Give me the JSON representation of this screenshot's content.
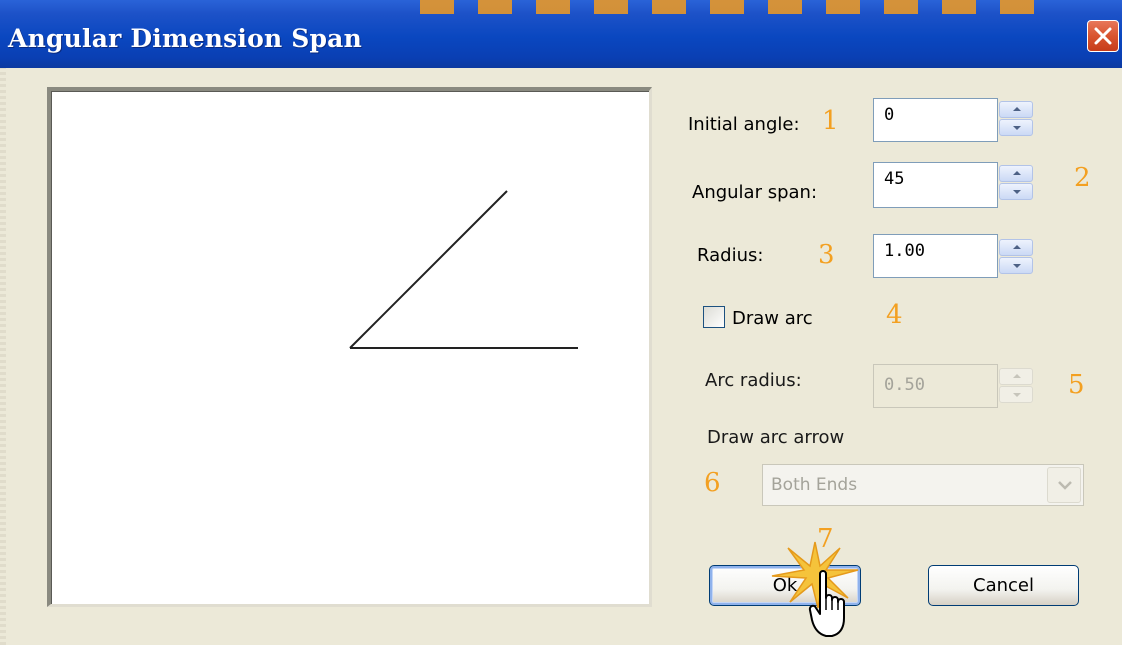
{
  "window": {
    "title": "Angular Dimension Span"
  },
  "fields": {
    "initial_angle": {
      "label": "Initial angle:",
      "value": "0",
      "callout": "1"
    },
    "angular_span": {
      "label": "Angular span:",
      "value": "45",
      "callout": "2"
    },
    "radius": {
      "label": "Radius:",
      "value": "1.00",
      "callout": "3"
    },
    "draw_arc": {
      "label": "Draw arc",
      "checked": false,
      "callout": "4"
    },
    "arc_radius": {
      "label": "Arc radius:",
      "value": "0.50",
      "disabled": true,
      "callout": "5"
    },
    "draw_arc_arrow": {
      "label": "Draw arc arrow",
      "selected": "Both Ends",
      "disabled": true,
      "callout": "6"
    }
  },
  "buttons": {
    "ok": {
      "label": "Ok",
      "callout": "7"
    },
    "cancel": {
      "label": "Cancel"
    }
  },
  "preview": {
    "initial_angle_deg": 0,
    "span_deg": 45
  },
  "colors": {
    "titlebar": "#0a47c0",
    "callout": "#f3a021",
    "dialog_bg": "#ece9d8"
  },
  "icons": [
    "close-icon",
    "spin-up-icon",
    "spin-down-icon",
    "dropdown-arrow-icon",
    "hand-cursor-icon"
  ]
}
